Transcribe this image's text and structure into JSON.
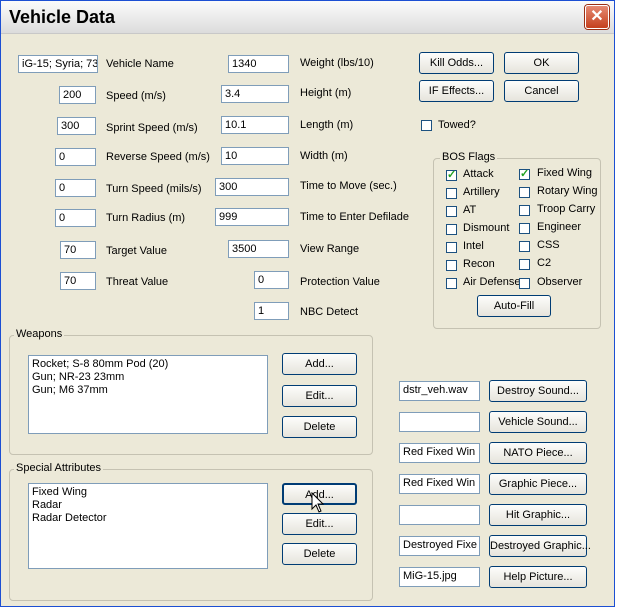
{
  "window": {
    "title": "Vehicle Data",
    "close_glyph": "✕"
  },
  "fields": {
    "vehicle_name": {
      "value": "iG-15; Syria; 73",
      "label": "Vehicle Name"
    },
    "speed": {
      "value": "200",
      "label": "Speed (m/s)"
    },
    "sprint_speed": {
      "value": "300",
      "label": "Sprint Speed (m/s)"
    },
    "reverse_speed": {
      "value": "0",
      "label": "Reverse Speed (m/s)"
    },
    "turn_speed": {
      "value": "0",
      "label": "Turn Speed (mils/s)"
    },
    "turn_radius": {
      "value": "0",
      "label": "Turn Radius (m)"
    },
    "target_value": {
      "value": "70",
      "label": "Target Value"
    },
    "threat_value": {
      "value": "70",
      "label": "Threat Value"
    },
    "weight": {
      "value": "1340",
      "label": "Weight (lbs/10)"
    },
    "height": {
      "value": "3.4",
      "label": "Height (m)"
    },
    "length": {
      "value": "10.1",
      "label": "Length (m)"
    },
    "width": {
      "value": "10",
      "label": "Width (m)"
    },
    "time_to_move": {
      "value": "300",
      "label": "Time to Move (sec.)"
    },
    "time_to_defilade": {
      "value": "999",
      "label": "Time to Enter Defilade"
    },
    "view_range": {
      "value": "3500",
      "label": "View Range"
    },
    "protection_value": {
      "value": "0",
      "label": "Protection Value"
    },
    "nbc_detect": {
      "value": "1",
      "label": "NBC Detect"
    }
  },
  "buttons": {
    "kill_odds": "Kill Odds...",
    "ok": "OK",
    "if_effects": "IF Effects...",
    "cancel": "Cancel",
    "auto_fill": "Auto-Fill",
    "weapons_add": "Add...",
    "weapons_edit": "Edit...",
    "weapons_delete": "Delete",
    "attr_add": "Add...",
    "attr_edit": "Edit...",
    "attr_delete": "Delete"
  },
  "towed": {
    "label": "Towed?",
    "checked": false
  },
  "bos_flags": {
    "title": "BOS Flags",
    "left": [
      {
        "label": "Attack",
        "checked": true
      },
      {
        "label": "Artillery",
        "checked": false
      },
      {
        "label": "AT",
        "checked": false
      },
      {
        "label": "Dismount",
        "checked": false
      },
      {
        "label": "Intel",
        "checked": false
      },
      {
        "label": "Recon",
        "checked": false
      },
      {
        "label": "Air Defense",
        "checked": false
      }
    ],
    "right": [
      {
        "label": "Fixed Wing",
        "checked": true
      },
      {
        "label": "Rotary Wing",
        "checked": false
      },
      {
        "label": "Troop Carry",
        "checked": false
      },
      {
        "label": "Engineer",
        "checked": false
      },
      {
        "label": "CSS",
        "checked": false
      },
      {
        "label": "C2",
        "checked": false
      },
      {
        "label": "Observer",
        "checked": false
      }
    ]
  },
  "weapons": {
    "title": "Weapons",
    "items": [
      "Rocket; S-8 80mm Pod (20)",
      "Gun; NR-23 23mm",
      "Gun; M6 37mm"
    ]
  },
  "special_attributes": {
    "title": "Special Attributes",
    "items": [
      "Fixed Wing",
      "Radar",
      "Radar Detector"
    ]
  },
  "assets": [
    {
      "value": "dstr_veh.wav",
      "button": "Destroy Sound..."
    },
    {
      "value": "",
      "button": "Vehicle Sound..."
    },
    {
      "value": "Red Fixed Win",
      "button": "NATO Piece..."
    },
    {
      "value": "Red Fixed Win",
      "button": "Graphic Piece..."
    },
    {
      "value": "",
      "button": "Hit Graphic..."
    },
    {
      "value": "Destroyed Fixe",
      "button": "Destroyed Graphic..."
    },
    {
      "value": "MiG-15.jpg",
      "button": "Help Picture..."
    }
  ]
}
